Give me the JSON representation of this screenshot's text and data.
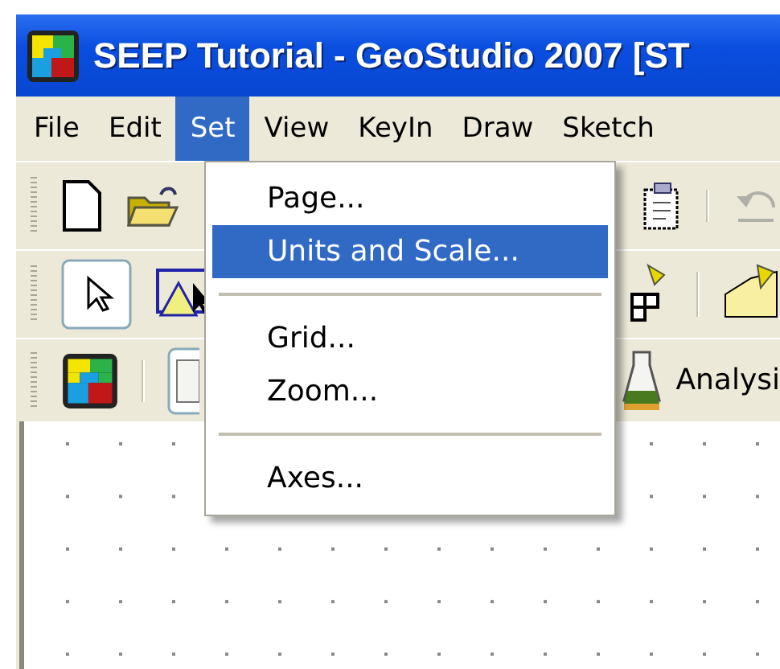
{
  "window": {
    "title": "SEEP Tutorial - GeoStudio 2007 [ST"
  },
  "menu_bar": [
    {
      "label": "File",
      "selected": false
    },
    {
      "label": "Edit",
      "selected": false
    },
    {
      "label": "Set",
      "selected": true
    },
    {
      "label": "View",
      "selected": false
    },
    {
      "label": "KeyIn",
      "selected": false
    },
    {
      "label": "Draw",
      "selected": false
    },
    {
      "label": "Sketch",
      "selected": false
    }
  ],
  "dropdown": [
    {
      "kind": "item",
      "label": "Page...",
      "selected": false
    },
    {
      "kind": "item",
      "label": "Units and Scale...",
      "selected": true
    },
    {
      "kind": "separator"
    },
    {
      "kind": "item",
      "label": "Grid...",
      "selected": false
    },
    {
      "kind": "item",
      "label": "Zoom...",
      "selected": false
    },
    {
      "kind": "separator"
    },
    {
      "kind": "item",
      "label": "Axes...",
      "selected": false
    }
  ],
  "toolbar_3": {
    "label": "Analysi"
  }
}
